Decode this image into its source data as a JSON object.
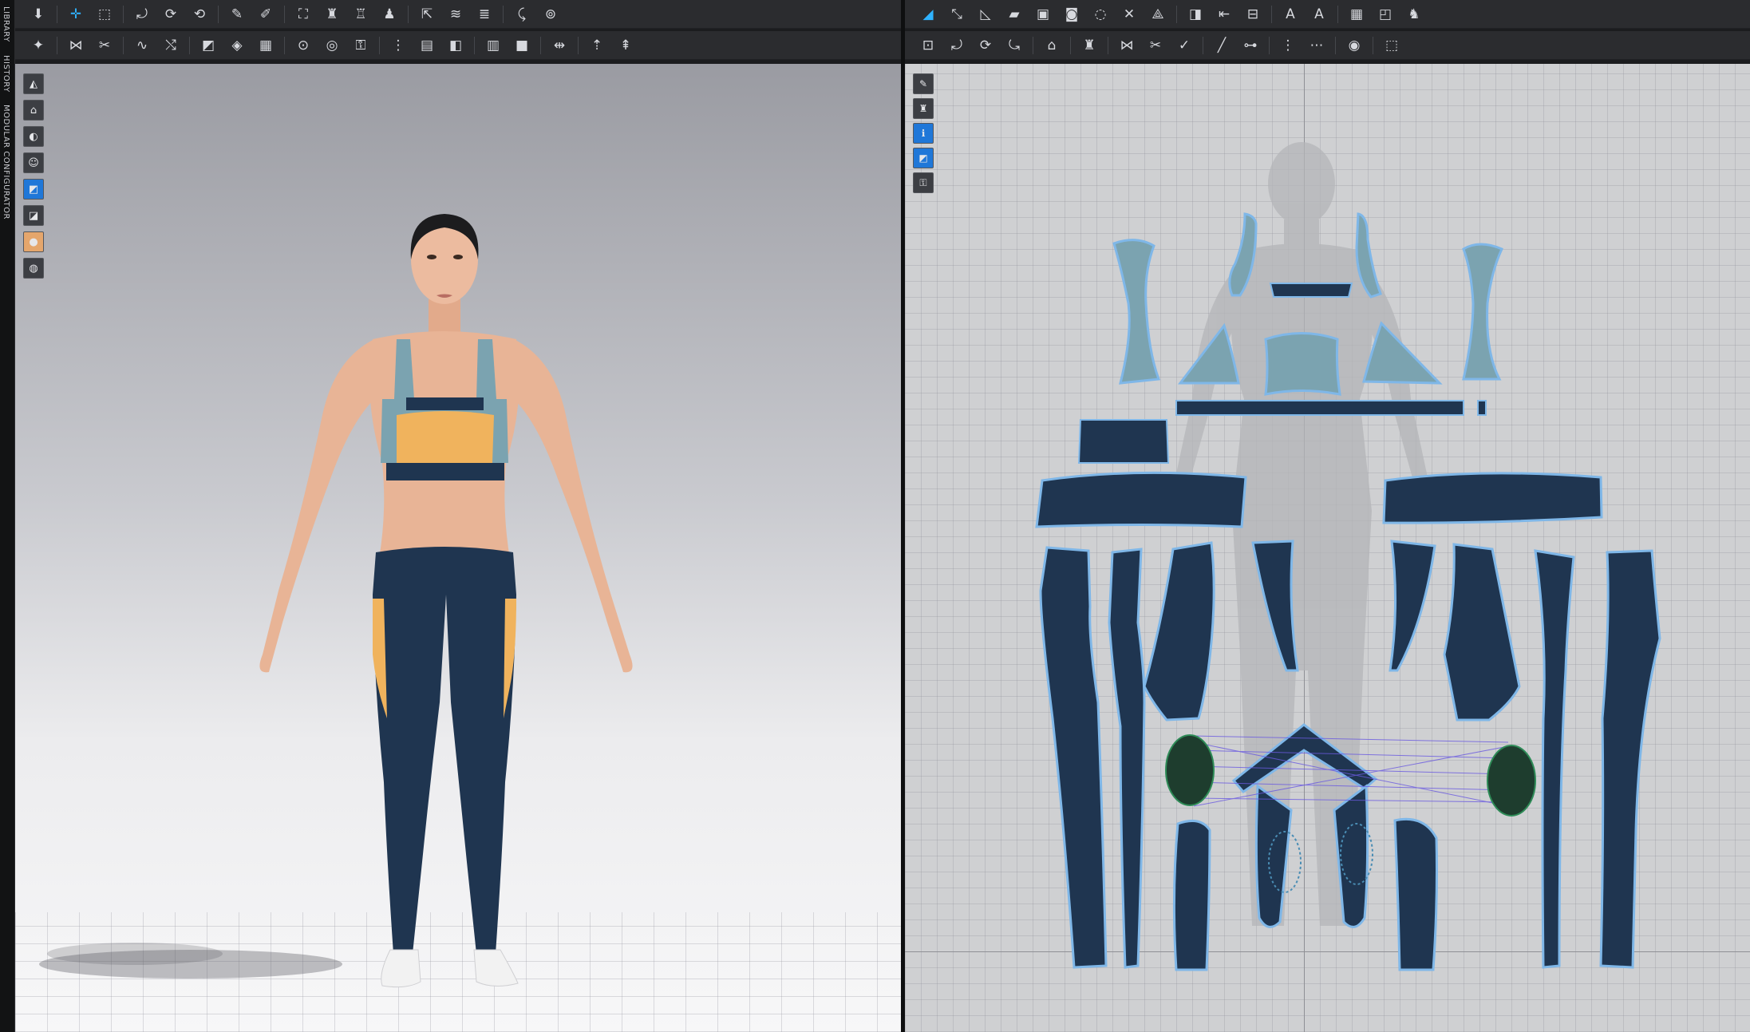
{
  "side_tabs": [
    "LIBRARY",
    "HISTORY",
    "MODULAR CONFIGURATOR"
  ],
  "toolbars": {
    "left_row1": [
      {
        "name": "download-tool-icon",
        "glyph": "⬇"
      },
      {
        "sep": true
      },
      {
        "name": "select-move-tool-icon",
        "glyph": "✛",
        "active": true
      },
      {
        "name": "transform-tool-icon",
        "glyph": "⬚"
      },
      {
        "sep": true
      },
      {
        "name": "arrange-tool-icon",
        "glyph": "⤾"
      },
      {
        "name": "fold-tool-icon",
        "glyph": "⟳"
      },
      {
        "name": "fold-arrangement-icon",
        "glyph": "⟲"
      },
      {
        "sep": true
      },
      {
        "name": "pen-tool-icon",
        "glyph": "✎"
      },
      {
        "name": "edit-pattern-icon",
        "glyph": "✐"
      },
      {
        "sep": true
      },
      {
        "name": "garment-fit-icon",
        "glyph": "⛶"
      },
      {
        "name": "garment-shirt-icon",
        "glyph": "♜"
      },
      {
        "name": "garment-dress-icon",
        "glyph": "♖"
      },
      {
        "name": "garment-avatar-icon",
        "glyph": "♟"
      },
      {
        "sep": true
      },
      {
        "name": "measure-tool-icon",
        "glyph": "⇱"
      },
      {
        "name": "layer-tool-icon",
        "glyph": "≋"
      },
      {
        "name": "layer-stack-icon",
        "glyph": "≣"
      },
      {
        "sep": true
      },
      {
        "name": "tack-tool-icon",
        "glyph": "⤹"
      },
      {
        "name": "pin-tool-icon",
        "glyph": "⊚"
      }
    ],
    "left_row2": [
      {
        "name": "simulate-avatar-icon",
        "glyph": "✦"
      },
      {
        "sep": true
      },
      {
        "name": "sewing-segment-icon",
        "glyph": "⋈"
      },
      {
        "name": "sewing-free-icon",
        "glyph": "✂"
      },
      {
        "sep": true
      },
      {
        "name": "curve-sewing-icon",
        "glyph": "∿"
      },
      {
        "name": "edit-sewing-icon",
        "glyph": "⤭"
      },
      {
        "sep": true
      },
      {
        "name": "texture-tool-icon",
        "glyph": "◩"
      },
      {
        "name": "pattern-tool-icon",
        "glyph": "◈"
      },
      {
        "name": "graphic-tool-icon",
        "glyph": "▦"
      },
      {
        "sep": true
      },
      {
        "name": "button-tool-icon",
        "glyph": "⊙"
      },
      {
        "name": "buttonhole-tool-icon",
        "glyph": "◎"
      },
      {
        "name": "zipper-tool-icon",
        "glyph": "⚿"
      },
      {
        "sep": true
      },
      {
        "name": "topstitch-tool-icon",
        "glyph": "⋮"
      },
      {
        "name": "piping-tool-icon",
        "glyph": "▤"
      },
      {
        "name": "fabric-tool-icon",
        "glyph": "◧"
      },
      {
        "sep": true
      },
      {
        "name": "fold-line-icon",
        "glyph": "▥"
      },
      {
        "name": "solidify-icon",
        "glyph": "■"
      },
      {
        "sep": true
      },
      {
        "name": "split-tool-icon",
        "glyph": "⇹"
      },
      {
        "sep": true
      },
      {
        "name": "measure-garment-icon",
        "glyph": "⇡"
      },
      {
        "name": "measure-length-icon",
        "glyph": "⇞"
      }
    ],
    "right_row1": [
      {
        "name": "edit-pattern-2d-icon",
        "glyph": "◢",
        "active": true
      },
      {
        "name": "transform-pattern-icon",
        "glyph": "⤡"
      },
      {
        "name": "edit-curvature-icon",
        "glyph": "◺"
      },
      {
        "name": "polygon-tool-icon",
        "glyph": "▰"
      },
      {
        "name": "rectangle-tool-icon",
        "glyph": "▣"
      },
      {
        "name": "ellipse-tool-icon",
        "glyph": "◙"
      },
      {
        "name": "internal-shape-icon",
        "glyph": "◌"
      },
      {
        "name": "cut-tool-icon",
        "glyph": "✕"
      },
      {
        "name": "dart-tool-icon",
        "glyph": "⟁"
      },
      {
        "sep": true
      },
      {
        "name": "trace-tool-icon",
        "glyph": "◨"
      },
      {
        "name": "grading-tool-icon",
        "glyph": "⇤"
      },
      {
        "name": "seam-allowance-icon",
        "glyph": "⊟"
      },
      {
        "sep": true
      },
      {
        "name": "annotation-text-icon",
        "glyph": "A"
      },
      {
        "name": "annotation-label-icon",
        "glyph": "A"
      },
      {
        "sep": true
      },
      {
        "name": "grid-tool-icon",
        "glyph": "▦"
      },
      {
        "name": "pattern-piece-icon",
        "glyph": "◰"
      },
      {
        "name": "avatar-pose-icon",
        "glyph": "♞"
      }
    ],
    "right_row2": [
      {
        "name": "pattern-arrange-icon",
        "glyph": "⊡"
      },
      {
        "name": "pattern-rotate-icon",
        "glyph": "⤾"
      },
      {
        "name": "pattern-fold-icon",
        "glyph": "⟳"
      },
      {
        "name": "pattern-unfold-icon",
        "glyph": "⤿"
      },
      {
        "sep": true
      },
      {
        "name": "iron-tool-icon",
        "glyph": "⌂"
      },
      {
        "sep": true
      },
      {
        "name": "garment-shirt-2d-icon",
        "glyph": "♜"
      },
      {
        "sep": true
      },
      {
        "name": "segment-sewing-2d-icon",
        "glyph": "⋈"
      },
      {
        "name": "free-sewing-2d-icon",
        "glyph": "✂"
      },
      {
        "name": "check-sewing-icon",
        "glyph": "✓"
      },
      {
        "sep": true
      },
      {
        "name": "line-tool-icon",
        "glyph": "╱"
      },
      {
        "name": "dimension-tool-icon",
        "glyph": "⊶"
      },
      {
        "sep": true
      },
      {
        "name": "topstitch-2d-icon",
        "glyph": "⋮"
      },
      {
        "name": "stitch-pattern-icon",
        "glyph": "⋯"
      },
      {
        "sep": true
      },
      {
        "name": "camera-snapshot-icon",
        "glyph": "◉"
      },
      {
        "sep": true
      },
      {
        "name": "selection-box-icon",
        "glyph": "⬚"
      }
    ]
  },
  "viewport_3d_tools": [
    {
      "name": "display-avatar-icon",
      "glyph": "◭",
      "style": ""
    },
    {
      "name": "display-garment-icon",
      "glyph": "⌂",
      "style": ""
    },
    {
      "name": "display-texture-icon",
      "glyph": "◐",
      "style": ""
    },
    {
      "name": "display-avatar-body-icon",
      "glyph": "☺",
      "style": ""
    },
    {
      "name": "display-fabric-icon",
      "glyph": "◩",
      "style": "blue"
    },
    {
      "name": "display-shading-icon",
      "glyph": "◪",
      "style": ""
    },
    {
      "name": "display-skin-icon",
      "glyph": "●",
      "style": "skin"
    },
    {
      "name": "display-environment-icon",
      "glyph": "◍",
      "style": ""
    }
  ],
  "viewport_2d_tools": [
    {
      "name": "show-pattern-tool-icon",
      "glyph": "✎",
      "style": ""
    },
    {
      "name": "show-garment-icon",
      "glyph": "♜",
      "style": ""
    },
    {
      "name": "show-info-icon",
      "glyph": "ℹ",
      "style": "blue"
    },
    {
      "name": "show-fabric-icon",
      "glyph": "◩",
      "style": "blue"
    },
    {
      "name": "lock-pattern-icon",
      "glyph": "⚿",
      "style": ""
    }
  ],
  "colors": {
    "navy": "#1f3550",
    "teal": "#7ba3b0",
    "orange": "#f0b35d",
    "skin": "#e8b496",
    "pattern_outline": "#7fb7e8",
    "point": "#2e8b57"
  }
}
